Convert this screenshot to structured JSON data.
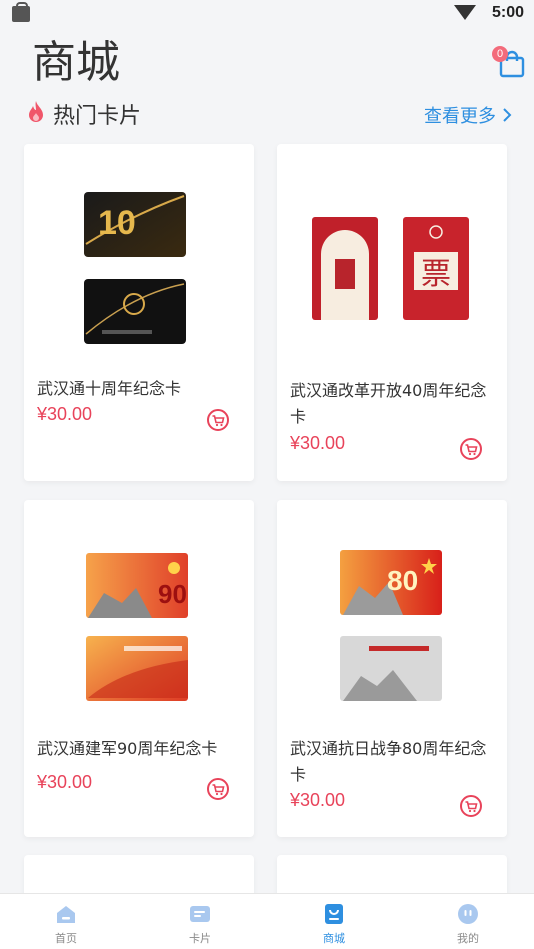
{
  "status_bar": {
    "time": "5:00"
  },
  "header": {
    "title": "商城",
    "cart_count": "0"
  },
  "section": {
    "title": "热门卡片",
    "more_label": "查看更多"
  },
  "products": [
    {
      "name": "武汉通十周年纪念卡",
      "price": "¥30.00"
    },
    {
      "name": "武汉通改革开放40周年纪念卡",
      "price": "¥30.00"
    },
    {
      "name": "武汉通建军90周年纪念卡",
      "price": "¥30.00"
    },
    {
      "name": "武汉通抗日战争80周年纪念卡",
      "price": "¥30.00"
    }
  ],
  "card_art_text": {
    "card1_top": "10",
    "card2_right": "票",
    "card3_top": "90",
    "card4_top": "80"
  },
  "tabbar": {
    "tabs": [
      {
        "label": "首页"
      },
      {
        "label": "卡片"
      },
      {
        "label": "商城"
      },
      {
        "label": "我的"
      }
    ]
  },
  "colors": {
    "accent": "#2e8fe0",
    "price": "#e8435a",
    "badge": "#f36b7b",
    "cart_icon": "#e8435a"
  }
}
